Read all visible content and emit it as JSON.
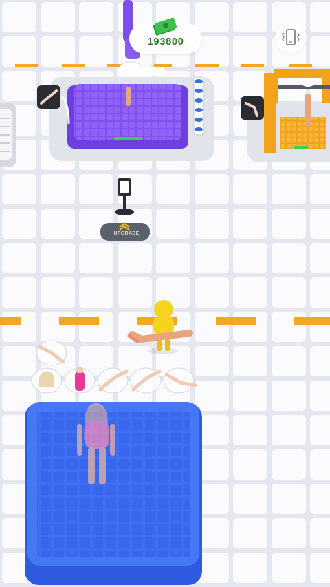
{
  "hud": {
    "money": "193800",
    "money_icon": "cash-stack-icon",
    "vibration_icon": "phone-vibrate-icon"
  },
  "upgrade_station": {
    "label": "UPGRADE",
    "icon": "double-chevron-up-icon"
  },
  "part_icons": {
    "left_printer": "arm-part-icon",
    "right_printer": "leg-part-icon"
  },
  "carried_parts": [
    "leg",
    "head",
    "torso",
    "arm",
    "arm",
    "leg"
  ],
  "colors": {
    "floor": "#eef0f6",
    "grid_tile": "#ffffff",
    "lane_marker": "#f5a623",
    "purple_printer": "#8a5cf0",
    "blue_pad": "#3f6ef2",
    "player": "#f7d21e",
    "money_green": "#2f7d2b"
  }
}
